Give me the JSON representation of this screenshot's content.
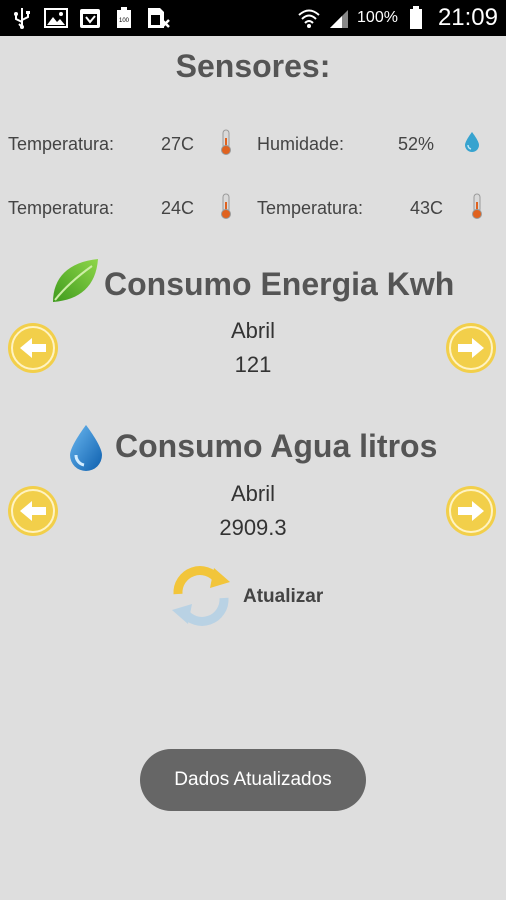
{
  "status_bar": {
    "battery_percent": "100%",
    "time": "21:09",
    "icons": [
      "usb-icon",
      "image-icon",
      "calendar-icon",
      "battery-100-icon",
      "sim-icon",
      "wifi-icon",
      "signal-icon",
      "battery-icon"
    ]
  },
  "title": "Sensores:",
  "sensors": [
    {
      "label": "Temperatura:",
      "value": "27C",
      "icon": "thermometer-icon"
    },
    {
      "label": "Humidade:",
      "value": "52%",
      "icon": "water-drop-icon"
    },
    {
      "label": "Temperatura:",
      "value": "24C",
      "icon": "thermometer-icon"
    },
    {
      "label": "Temperatura:",
      "value": "43C",
      "icon": "thermometer-icon"
    }
  ],
  "energy": {
    "title": "Consumo Energia Kwh",
    "month": "Abril",
    "value": "121",
    "icon": "leaf-icon"
  },
  "water": {
    "title": "Consumo Agua litros",
    "month": "Abril",
    "value": "2909.3",
    "icon": "water-drop-icon"
  },
  "refresh": {
    "label": "Atualizar",
    "icon": "refresh-icon"
  },
  "toast": {
    "message": "Dados Atualizados"
  },
  "colors": {
    "background": "#dedede",
    "arrow_button": "#f2cf4a",
    "leaf": "#4caf2a",
    "water_drop": "#1f7fd0",
    "toast": "#666666"
  }
}
